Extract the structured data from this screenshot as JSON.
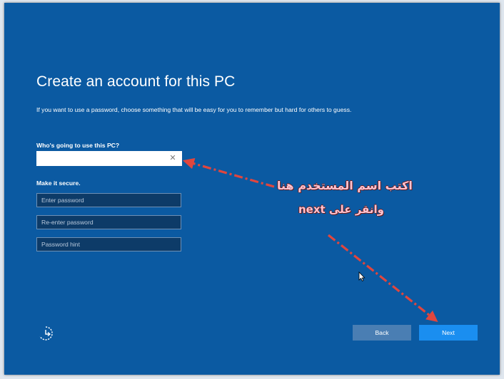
{
  "setup": {
    "title": "Create an account for this PC",
    "description": "If you want to use a password, choose something that will be easy for you to remember but hard for others to guess.",
    "username_label": "Who's going to use this PC?",
    "username_value": "",
    "secure_label": "Make it secure.",
    "password_placeholder": "Enter password",
    "reenter_placeholder": "Re-enter password",
    "hint_placeholder": "Password hint",
    "back_label": "Back",
    "next_label": "Next"
  },
  "annotations": {
    "line1": "اكتب اسم المستخدم هنا",
    "line2": "وانقر على next"
  },
  "colors": {
    "background": "#0b5aa2",
    "next_button": "#1a8ef0",
    "back_button": "#4a7eb3",
    "annotation_arrow": "#e0463e"
  },
  "icons": {
    "clear": "close-icon",
    "accessibility": "ease-of-access-icon",
    "pointer": "mouse-pointer-icon"
  }
}
